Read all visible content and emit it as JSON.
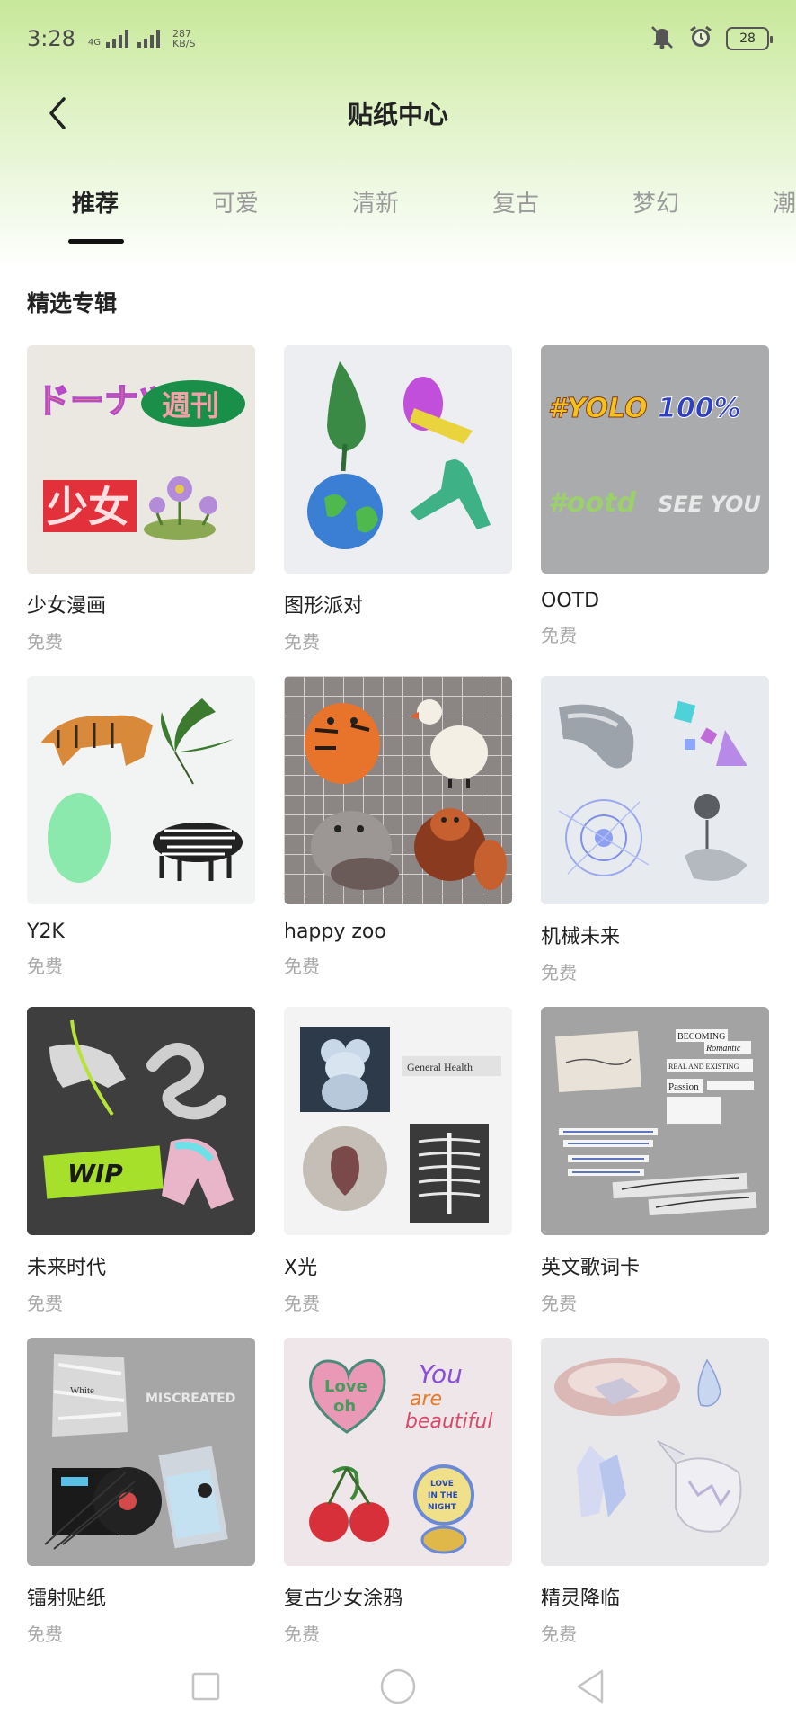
{
  "status_bar": {
    "time": "3:28",
    "network": "4G",
    "speed_value": "287",
    "speed_unit": "KB/S",
    "battery": "28",
    "icons": [
      "signal-icon",
      "mute-icon",
      "alarm-icon",
      "battery-icon"
    ]
  },
  "header": {
    "title": "贴纸中心",
    "back_icon": "chevron-left-icon"
  },
  "tabs": [
    {
      "label": "推荐",
      "active": true
    },
    {
      "label": "可爱",
      "active": false
    },
    {
      "label": "清新",
      "active": false
    },
    {
      "label": "复古",
      "active": false
    },
    {
      "label": "梦幻",
      "active": false
    },
    {
      "label": "潮",
      "active": false
    }
  ],
  "section": {
    "title": "精选专辑"
  },
  "albums": [
    {
      "name": "少女漫画",
      "price": "免费",
      "thumb_texts": [
        "ドーナツ",
        "週刊",
        "少女"
      ],
      "bg": "#ebe8e1"
    },
    {
      "name": "图形派对",
      "price": "免费",
      "thumb_texts": [],
      "bg": "#eceef1"
    },
    {
      "name": "OOTD",
      "price": "免费",
      "thumb_texts": [
        "#YOLO",
        "100%",
        "#ootd",
        "SEE YOU"
      ],
      "bg": "#a9abad"
    },
    {
      "name": "Y2K",
      "price": "免费",
      "thumb_texts": [],
      "bg": "#f2f3f3"
    },
    {
      "name": "happy zoo",
      "price": "免费",
      "thumb_texts": [],
      "bg": "#8b8584"
    },
    {
      "name": "机械未来",
      "price": "免费",
      "thumb_texts": [],
      "bg": "#e7eaee"
    },
    {
      "name": "未来时代",
      "price": "免费",
      "thumb_texts": [
        "WIP"
      ],
      "bg": "#3e3e3e"
    },
    {
      "name": "X光",
      "price": "免费",
      "thumb_texts": [
        "General Health"
      ],
      "bg": "#f3f3f3"
    },
    {
      "name": "英文歌词卡",
      "price": "免费",
      "thumb_texts": [
        "BECOMING",
        "Romantic",
        "REAL AND EXISTING",
        "Passion"
      ],
      "bg": "#a3a3a3"
    },
    {
      "name": "镭射贴纸",
      "price": "免费",
      "thumb_texts": [
        "MISCREATED",
        "White"
      ],
      "bg": "#a6a6a6"
    },
    {
      "name": "复古少女涂鸦",
      "price": "免费",
      "thumb_texts": [
        "Love",
        "oh",
        "You",
        "are",
        "beautiful",
        "LOVE",
        "IN THE",
        "NIGHT"
      ],
      "bg": "#efe6ea"
    },
    {
      "name": "精灵降临",
      "price": "免费",
      "thumb_texts": [],
      "bg": "#e8e7ea"
    }
  ],
  "nav_bar": {
    "icons": [
      "recent-apps-icon",
      "home-icon",
      "back-icon"
    ]
  },
  "colors": {
    "header_gradient_top": "#c8e89a",
    "active_tab": "#222222",
    "inactive_tab": "#9a9a9a",
    "price_text": "#a8a8a8"
  }
}
